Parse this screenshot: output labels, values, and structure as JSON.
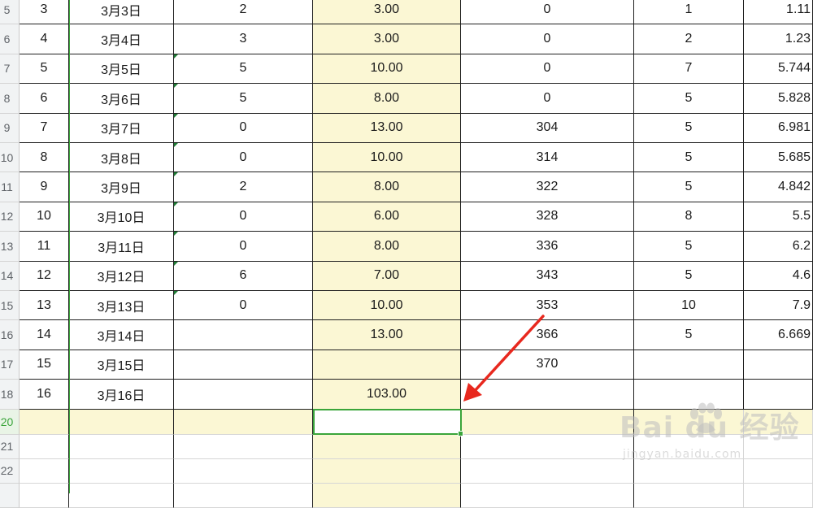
{
  "spreadsheet": {
    "row_headers": [
      "5",
      "6",
      "7",
      "8",
      "9",
      "10",
      "11",
      "12",
      "13",
      "14",
      "15",
      "16",
      "17",
      "18",
      "20",
      "21",
      "22",
      ""
    ],
    "active_row_header": "20",
    "rows": [
      [
        "3",
        "3月3日",
        "2",
        "3.00",
        "0",
        "1",
        "1.11"
      ],
      [
        "4",
        "3月4日",
        "3",
        "3.00",
        "0",
        "2",
        "1.23"
      ],
      [
        "5",
        "3月5日",
        "5",
        "10.00",
        "0",
        "7",
        "5.744"
      ],
      [
        "6",
        "3月6日",
        "5",
        "8.00",
        "0",
        "5",
        "5.828"
      ],
      [
        "7",
        "3月7日",
        "0",
        "13.00",
        "304",
        "5",
        "6.981"
      ],
      [
        "8",
        "3月8日",
        "0",
        "10.00",
        "314",
        "5",
        "5.685"
      ],
      [
        "9",
        "3月9日",
        "2",
        "8.00",
        "322",
        "5",
        "4.842"
      ],
      [
        "10",
        "3月10日",
        "0",
        "6.00",
        "328",
        "8",
        "5.5"
      ],
      [
        "11",
        "3月11日",
        "0",
        "8.00",
        "336",
        "5",
        "6.2"
      ],
      [
        "12",
        "3月12日",
        "6",
        "7.00",
        "343",
        "5",
        "4.6"
      ],
      [
        "13",
        "3月13日",
        "0",
        "10.00",
        "353",
        "10",
        "7.9"
      ],
      [
        "14",
        "3月14日",
        "",
        "13.00",
        "366",
        "5",
        "6.669"
      ],
      [
        "15",
        "3月15日",
        "",
        "",
        "370",
        "",
        ""
      ],
      [
        "16",
        "3月16日",
        "",
        "103.00",
        "",
        "",
        ""
      ],
      [
        "",
        "",
        "",
        "",
        "",
        "",
        ""
      ],
      [
        "",
        "",
        "",
        "",
        "",
        "",
        ""
      ],
      [
        "",
        "",
        "",
        "",
        "",
        "",
        ""
      ],
      [
        "",
        "",
        "",
        "",
        "",
        "",
        ""
      ]
    ],
    "text_number_flag_rows": [
      2,
      3,
      4,
      5,
      6,
      7,
      8,
      9,
      10
    ]
  },
  "annotation": {
    "arrow_color": "#e8281e"
  },
  "watermark": {
    "logo_text": "Bai du 经验",
    "url_text": "jingyan.baidu.com"
  },
  "colors": {
    "highlight_column": "#fbf7d4",
    "selection_green": "#3aa53a"
  }
}
